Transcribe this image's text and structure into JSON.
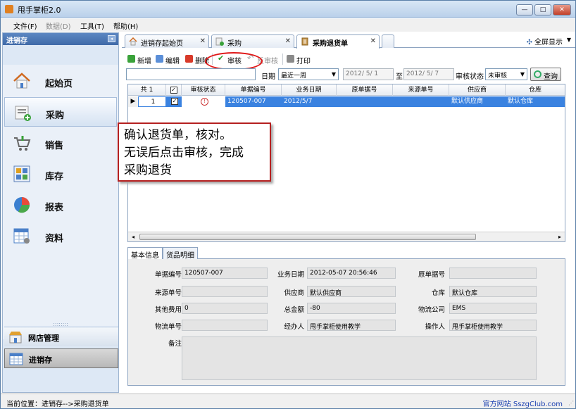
{
  "window": {
    "title": "甩手掌柜2.0",
    "min": "—",
    "max": "□",
    "close": "✕"
  },
  "menu": {
    "file": "文件(F)",
    "data": "数据(D)",
    "tools": "工具(T)",
    "help": "帮助(H)"
  },
  "sidebar": {
    "header": "进销存",
    "pin": "◂",
    "items": [
      {
        "label": "起始页",
        "icon": "home-icon"
      },
      {
        "label": "采购",
        "icon": "purchase-icon"
      },
      {
        "label": "销售",
        "icon": "cart-icon"
      },
      {
        "label": "库存",
        "icon": "inventory-icon"
      },
      {
        "label": "报表",
        "icon": "pie-chart-icon"
      },
      {
        "label": "资料",
        "icon": "data-sheet-icon"
      }
    ],
    "grip": "::::::::",
    "bottom": [
      {
        "label": "网店管理",
        "icon": "shop-icon"
      },
      {
        "label": "进销存",
        "icon": "inventory-sheet-icon"
      }
    ]
  },
  "tabs": [
    {
      "label": "进销存起始页",
      "close": "✕"
    },
    {
      "label": "采购",
      "close": "✕"
    },
    {
      "label": "采购退货单",
      "close": "✕"
    }
  ],
  "fullscreen": {
    "label": "全屏显示",
    "icon": "✣",
    "arrow": "▼"
  },
  "toolbar": {
    "add": "新增",
    "edit": "编辑",
    "delete": "删除",
    "audit": "审核",
    "unaudit": "反审核",
    "print": "打印"
  },
  "filter": {
    "date_label": "日期",
    "date_range": "最近一周",
    "date_from": "2012/ 5/ 1",
    "to_label": "至",
    "date_to": "2012/ 5/ 7",
    "status_label": "审核状态",
    "status_value": "未审核",
    "query": "查询",
    "arrow": "▼"
  },
  "grid": {
    "total": "共 1",
    "headers": [
      "审核状态",
      "单据编号",
      "业务日期",
      "原单据号",
      "来源单号",
      "供应商",
      "仓库"
    ],
    "checkmark": "✓",
    "row_pointer": "▶",
    "rows": [
      {
        "num": "1",
        "status": "!",
        "doc_no": "120507-007",
        "date": "2012/5/7",
        "orig_no": "",
        "source_no": "",
        "supplier": "默认供应商",
        "warehouse": "默认仓库"
      }
    ],
    "scroll_left": "◂",
    "scroll_right": "▸"
  },
  "callout": {
    "line1": "确认退货单，核对。",
    "line2": "无误后点击审核，完成",
    "line3": "采购退货"
  },
  "detail_tabs": [
    "基本信息",
    "货品明细"
  ],
  "detail": {
    "doc_no_label": "单据编号",
    "doc_no": "120507-007",
    "biz_date_label": "业务日期",
    "biz_date": "2012-05-07 20:56:46",
    "orig_no_label": "原单据号",
    "orig_no": "",
    "source_label": "来源单号",
    "source": "",
    "supplier_label": "供应商",
    "supplier": "默认供应商",
    "warehouse_label": "仓库",
    "warehouse": "默认仓库",
    "other_fee_label": "其他费用",
    "other_fee": "0",
    "total_label": "总金额",
    "total": "-80",
    "logistics_label": "物流公司",
    "logistics": "EMS",
    "tracking_label": "物流单号",
    "tracking": "",
    "handler_label": "经办人",
    "handler": "甩手掌柜使用教学",
    "operator_label": "操作人",
    "operator": "甩手掌柜使用教学",
    "remark_label": "备注",
    "remark": ""
  },
  "status": {
    "location": "当前位置：进销存-->采购退货单",
    "site": "官方网站 SszgClub.com",
    "grip": "⋰"
  }
}
